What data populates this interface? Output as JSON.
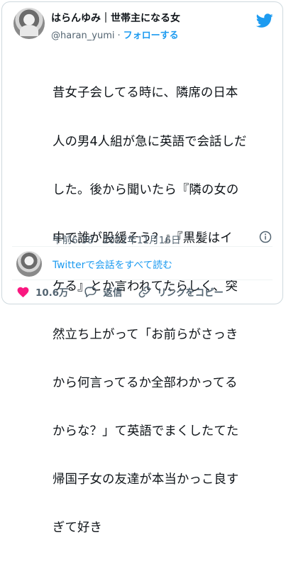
{
  "tweet": {
    "author_name": "はらんゆみ｜世帯主になる女",
    "handle": "@haran_yumi",
    "separator": "·",
    "follow_label": "フォローする",
    "lines": [
      "昔女子会してる時に、隣席の日本",
      "人の男4人組が急に英語で会話しだ",
      "した。後から聞いたら『隣の女の",
      "中で誰が股緩そう？』『黒髪はイ",
      "ケる』とか言われてたらしく、突",
      "然立ち上がって「お前らがさっき",
      "から何言ってるか全部わかってる",
      "からな？」て英語でまくしたてた",
      "帰国子女の友達が本当かっこ良す",
      "ぎて好き"
    ],
    "timestamp": "午前6:38 · 2022年11月16日"
  },
  "conversation": {
    "label": "Twitterで会話をすべて読む"
  },
  "actions": {
    "like_count": "10.6万",
    "reply_label": "返信",
    "copy_link_label": "リンクをコピー"
  },
  "colors": {
    "accent": "#1d9bf0",
    "like": "#f91880",
    "muted": "#536471"
  },
  "icons": [
    "twitter-bird-icon",
    "info-icon",
    "heart-icon",
    "reply-icon",
    "link-icon"
  ]
}
